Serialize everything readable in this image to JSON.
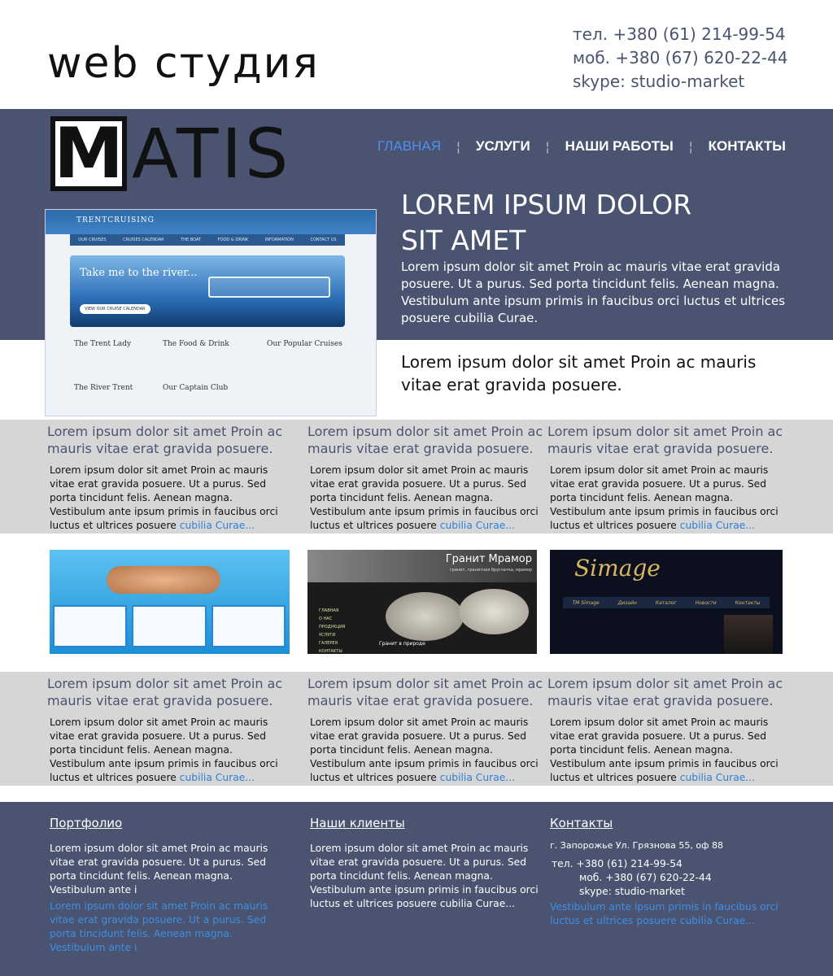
{
  "header": {
    "logo_web": "web студия",
    "logo_m": "M",
    "logo_rest": "ATIS",
    "phone": "тел. +380 (61) 214-99-54",
    "mobile": "моб. +380 (67) 620-22-44",
    "skype": "skype: studio-market"
  },
  "nav": [
    {
      "label": "ГЛАВНАЯ"
    },
    {
      "label": "УСЛУГИ"
    },
    {
      "label": "НАШИ РАБОТЫ"
    },
    {
      "label": "КОНТАКТЫ"
    }
  ],
  "hero": {
    "title_line1": "LOREM IPSUM DOLOR",
    "title_line2": "SIT AMET",
    "text": "Lorem ipsum dolor sit amet Proin ac mauris vitae erat gravida posuere. Ut a purus. Sed porta tincidunt felis. Aenean magna. Vestibulum ante ipsum primis in faucibus orci luctus et ultrices posuere cubilia Curae.",
    "sub": "Lorem ipsum dolor sit amet Proin ac mauris vitae erat gravida posuere."
  },
  "hero_screenshot": {
    "brand": "TRENTCRUISING",
    "menu": [
      "OUR CRUISES",
      "CRUISES CALENDAR",
      "THE BOAT",
      "FOOD & DRINK",
      "INFORMATION",
      "CONTACT US"
    ],
    "banner": "Take me to the river...",
    "banner_button": "VIEW OUR CRUISE CALENDAR",
    "cards": [
      "The Trent Lady",
      "The Food & Drink",
      "The River Trent",
      "Our Captain Club"
    ],
    "popular": "Our Popular Cruises"
  },
  "cards": [
    {
      "title": "Lorem ipsum dolor sit amet Proin ac mauris vitae erat gravida posuere.",
      "text": "Lorem ipsum dolor sit amet Proin ac mauris vitae erat gravida posuere. Ut a purus. Sed porta tincidunt felis. Aenean magna. Vestibulum ante ipsum primis in faucibus orci luctus et ultrices posuere ",
      "link": "cubilia Curae..."
    },
    {
      "title": "Lorem ipsum dolor sit amet Proin ac mauris vitae erat gravida posuere.",
      "text": "Lorem ipsum dolor sit amet Proin ac mauris vitae erat gravida posuere. Ut a purus. Sed porta tincidunt felis. Aenean magna. Vestibulum ante ipsum primis in faucibus orci luctus et ultrices posuere ",
      "link": "cubilia Curae..."
    },
    {
      "title": "Lorem ipsum dolor sit amet Proin ac mauris vitae erat gravida posuere.",
      "text": "Lorem ipsum dolor sit amet Proin ac mauris vitae erat gravida posuere. Ut a purus. Sed porta tincidunt felis. Aenean magna. Vestibulum ante ipsum primis in faucibus orci luctus et ultrices posuere ",
      "link": "cubilia Curae..."
    }
  ],
  "cards2": [
    {
      "title": "Lorem ipsum dolor sit amet Proin ac mauris vitae erat gravida posuere.",
      "text": "Lorem ipsum dolor sit amet Proin ac mauris vitae erat gravida posuere. Ut a purus. Sed porta tincidunt felis. Aenean magna. Vestibulum ante ipsum primis in faucibus orci luctus et ultrices posuere ",
      "link": "cubilia Curae..."
    },
    {
      "title": "Lorem ipsum dolor sit amet Proin ac mauris vitae erat gravida posuere.",
      "text": "Lorem ipsum dolor sit amet Proin ac mauris vitae erat gravida posuere. Ut a purus. Sed porta tincidunt felis. Aenean magna. Vestibulum ante ipsum primis in faucibus orci luctus et ultrices posuere ",
      "link": "cubilia Curae..."
    },
    {
      "title": "Lorem ipsum dolor sit amet Proin ac mauris vitae erat gravida posuere.",
      "text": "Lorem ipsum dolor sit amet Proin ac mauris vitae erat gravida posuere. Ut a purus. Sed porta tincidunt felis. Aenean magna. Vestibulum ante ipsum primis in faucibus orci luctus et ultrices posuere ",
      "link": "cubilia Curae..."
    }
  ],
  "thumbs": {
    "t2_title": "Гранит Мрамор",
    "t2_sub": "гранит, гранитная брусчатка, мрамор",
    "t2_menu": [
      "ГЛАВНАЯ",
      "О НАС",
      "ПРОДУКЦИЯ",
      "УСЛУГИ",
      "ГАЛЕРЕЯ",
      "КОНТАКТЫ"
    ],
    "t2_caption": "Гранит в природе",
    "t3_brand": "Simage",
    "t3_menu": [
      "ТМ Simage",
      "Дизайн",
      "Каталог",
      "Новости",
      "Контакты"
    ]
  },
  "footer": {
    "portfolio_title": "Портфолио",
    "portfolio_text": "Lorem ipsum dolor sit amet Proin ac mauris vitae erat gravida posuere. Ut a purus. Sed porta tincidunt felis. Aenean magna. Vestibulum ante i",
    "portfolio_link": "Lorem ipsum dolor sit amet Proin ac mauris vitae erat gravida posuere. Ut a purus. Sed porta tincidunt felis. Aenean magna. Vestibulum ante i",
    "clients_title": "Наши клиенты",
    "clients_text": "Lorem ipsum dolor sit amet Proin ac mauris vitae erat gravida posuere. Ut a purus. Sed porta tincidunt felis. Aenean magna. Vestibulum ante ipsum primis in faucibus orci luctus et ultrices posuere cubilia Curae...",
    "contacts_title": "Контакты",
    "address": "г. Запорожье Ул. Грязнова 55, оф 88",
    "phone": "тел. +380 (61) 214-99-54",
    "mobile": "моб. +380 (67) 620-22-44",
    "skype": "skype: studio-market",
    "contacts_link": "Vestibulum ante ipsum primis in faucibus orci luctus et ultrices posuere cubilia Curae..."
  },
  "colors": {
    "slate": "#4a5470",
    "band": "#d6d6d6",
    "link": "#2e7fd8",
    "active_nav": "#4f8ff0"
  }
}
